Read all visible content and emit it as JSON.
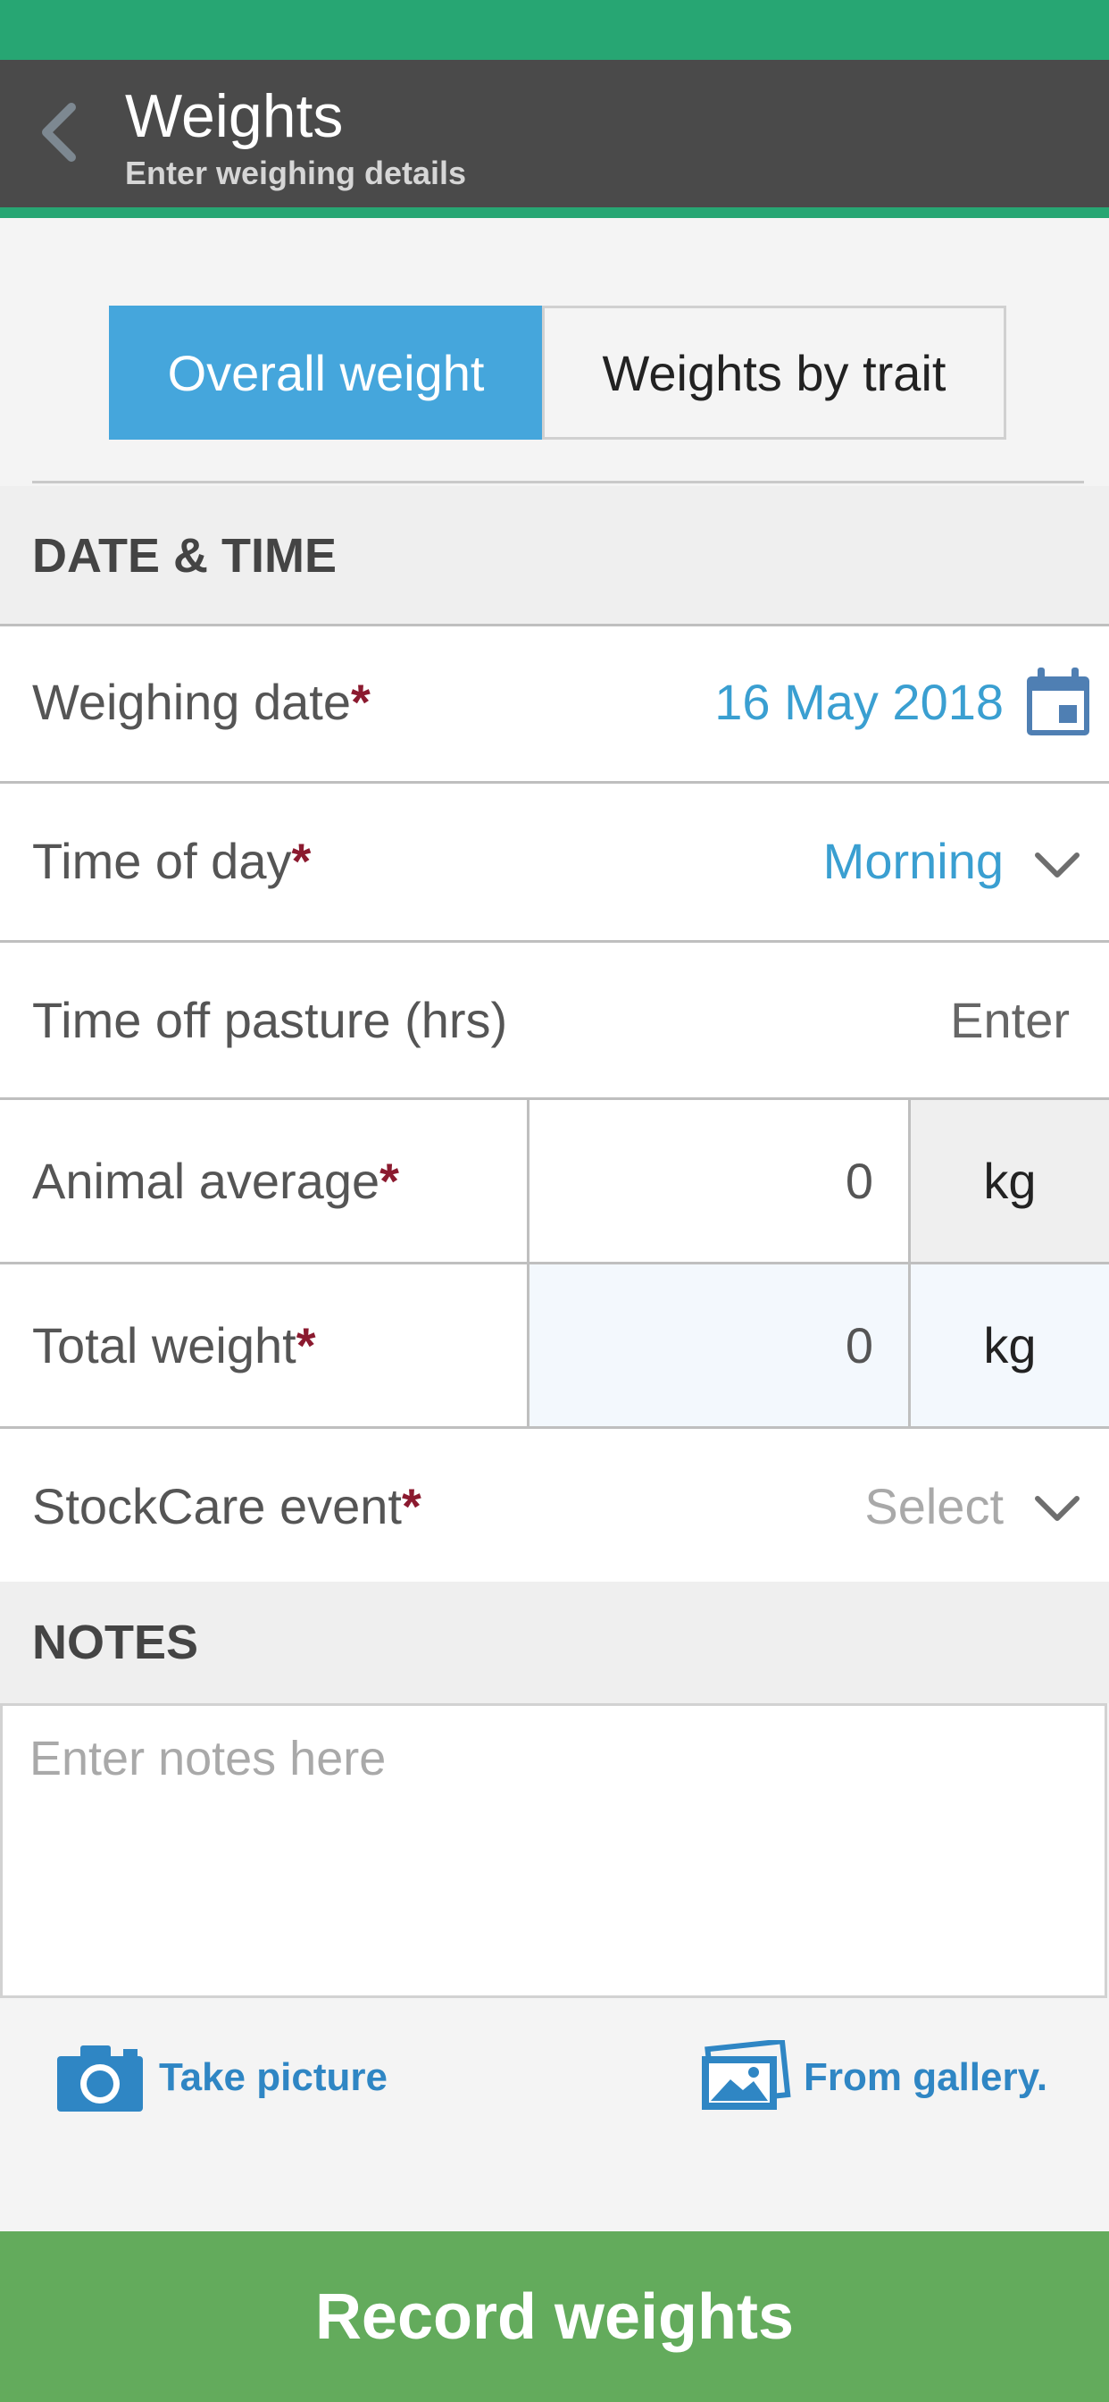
{
  "header": {
    "title": "Weights",
    "subtitle": "Enter weighing details",
    "back_icon": "chevron-left-icon"
  },
  "tabs": [
    {
      "label": "Overall weight",
      "active": true
    },
    {
      "label": "Weights by trait",
      "active": false
    }
  ],
  "sections": {
    "date_time": "DATE & TIME",
    "notes": "NOTES"
  },
  "fields": {
    "weighing_date": {
      "label": "Weighing date",
      "required": "*",
      "value": "16 May 2018",
      "icon": "calendar-icon"
    },
    "time_of_day": {
      "label": "Time of day",
      "required": "*",
      "value": "Morning",
      "icon": "chevron-down-icon"
    },
    "time_off_pasture": {
      "label": "Time off pasture (hrs)",
      "placeholder": "Enter"
    },
    "animal_average": {
      "label": "Animal average",
      "required": "*",
      "value": "0",
      "unit": "kg"
    },
    "total_weight": {
      "label": "Total weight",
      "required": "*",
      "value": "0",
      "unit": "kg"
    },
    "stockcare_event": {
      "label": "StockCare event",
      "required": "*",
      "placeholder": "Select",
      "icon": "chevron-down-icon"
    }
  },
  "notes": {
    "placeholder": "Enter notes here"
  },
  "media": {
    "take_picture": "Take picture",
    "from_gallery": "From gallery."
  },
  "cta": {
    "label": "Record weights"
  },
  "colors": {
    "status_green": "#27a673",
    "header_dark": "#4a4a4a",
    "accent_blue": "#45a6dc",
    "required_red": "#8b1a2f",
    "cta_green": "#63ab5c"
  }
}
